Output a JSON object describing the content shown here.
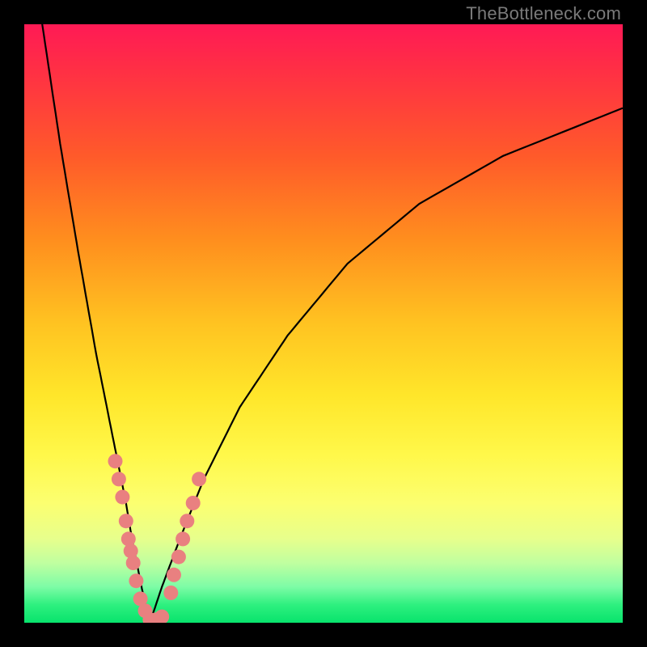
{
  "watermark": {
    "text": "TheBottleneck.com"
  },
  "colors": {
    "frame": "#000000",
    "curve_stroke": "#000000",
    "dot_fill": "#e98080",
    "gradient_stops": [
      "#ff1a55",
      "#ff3044",
      "#ff5a2a",
      "#ff8e1e",
      "#ffc321",
      "#ffe62a",
      "#fff84a",
      "#fcff70",
      "#e7ff8c",
      "#c0ffa0",
      "#7dfca6",
      "#2ef07f",
      "#08e36c"
    ]
  },
  "chart_data": {
    "type": "line",
    "title": "",
    "xlabel": "",
    "ylabel": "",
    "x_range": [
      0,
      100
    ],
    "y_range": [
      0,
      100
    ],
    "notes": "V-shaped bottleneck curve. No axis tick labels are visible; values are estimated from pixel position on a 0–100 normalized scale for both axes. Minimum of curve is near x≈21, y≈0.",
    "series": [
      {
        "name": "left-branch",
        "x": [
          3,
          6,
          9,
          12,
          15,
          17,
          18,
          19,
          20,
          21
        ],
        "y": [
          100,
          80,
          62,
          45,
          30,
          20,
          14,
          9,
          4,
          0
        ]
      },
      {
        "name": "right-branch",
        "x": [
          21,
          23,
          26,
          30,
          36,
          44,
          54,
          66,
          80,
          100
        ],
        "y": [
          0,
          6,
          14,
          24,
          36,
          48,
          60,
          70,
          78,
          86
        ]
      }
    ],
    "dot_clusters": [
      {
        "name": "left-cluster",
        "points": [
          {
            "x": 15.2,
            "y": 27
          },
          {
            "x": 15.8,
            "y": 24
          },
          {
            "x": 16.4,
            "y": 21
          },
          {
            "x": 17.0,
            "y": 17
          },
          {
            "x": 17.4,
            "y": 14
          },
          {
            "x": 17.8,
            "y": 12
          },
          {
            "x": 18.2,
            "y": 10
          },
          {
            "x": 18.7,
            "y": 7
          },
          {
            "x": 19.4,
            "y": 4
          },
          {
            "x": 20.2,
            "y": 2
          },
          {
            "x": 21.0,
            "y": 0.5
          },
          {
            "x": 22.0,
            "y": 0.5
          },
          {
            "x": 23.0,
            "y": 1.0
          }
        ]
      },
      {
        "name": "right-cluster",
        "points": [
          {
            "x": 24.5,
            "y": 5
          },
          {
            "x": 25.0,
            "y": 8
          },
          {
            "x": 25.8,
            "y": 11
          },
          {
            "x": 26.5,
            "y": 14
          },
          {
            "x": 27.2,
            "y": 17
          },
          {
            "x": 28.2,
            "y": 20
          },
          {
            "x": 29.2,
            "y": 24
          }
        ]
      }
    ]
  }
}
